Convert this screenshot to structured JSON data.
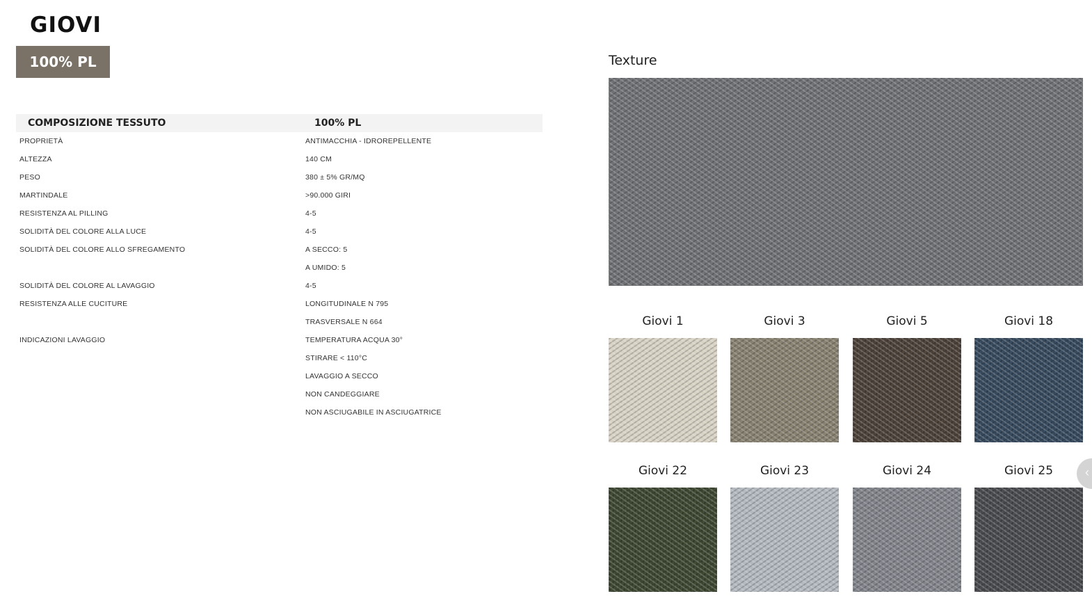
{
  "product": {
    "name": "GIOVI",
    "composition_badge": "100% PL"
  },
  "specs": {
    "header": {
      "label": "COMPOSIZIONE TESSUTO",
      "value": "100% PL"
    },
    "rows": [
      {
        "label": "PROPRIETÀ",
        "value": "ANTIMACCHIA - IDROREPELLENTE"
      },
      {
        "label": "ALTEZZA",
        "value": "140 CM"
      },
      {
        "label": "PESO",
        "value": "380 ± 5% GR/MQ"
      },
      {
        "label": "MARTINDALE",
        "value": ">90.000 GIRI"
      },
      {
        "label": "RESISTENZA AL PILLING",
        "value": "4-5"
      },
      {
        "label": "SOLIDITÀ DEL COLORE ALLA LUCE",
        "value": "4-5"
      },
      {
        "label": "SOLIDITÀ DEL COLORE ALLO SFREGAMENTO",
        "value": "A SECCO: 5"
      },
      {
        "label": "",
        "value": "A UMIDO: 5"
      },
      {
        "label": "SOLIDITÀ DEL COLORE AL LAVAGGIO",
        "value": "4-5"
      },
      {
        "label": "RESISTENZA ALLE CUCITURE",
        "value": "LONGITUDINALE N 795"
      },
      {
        "label": "",
        "value": "TRASVERSALE N 664"
      },
      {
        "label": "INDICAZIONI LAVAGGIO",
        "value": "TEMPERATURA ACQUA 30°"
      },
      {
        "label": "",
        "value": "STIRARE < 110°C"
      },
      {
        "label": "",
        "value": "LAVAGGIO A SECCO"
      },
      {
        "label": "",
        "value": "NON CANDEGGIARE"
      },
      {
        "label": "",
        "value": "NON ASCIUGABILE IN ASCIUGATRICE"
      }
    ]
  },
  "texture": {
    "title": "Texture",
    "color": "#6f7073"
  },
  "swatches": [
    {
      "name": "Giovi 1",
      "color": "#d8d2c4"
    },
    {
      "name": "Giovi 3",
      "color": "#86806f"
    },
    {
      "name": "Giovi 5",
      "color": "#4a4037"
    },
    {
      "name": "Giovi 18",
      "color": "#35485c"
    },
    {
      "name": "Giovi 22",
      "color": "#3c4530"
    },
    {
      "name": "Giovi 23",
      "color": "#b3b8bf"
    },
    {
      "name": "Giovi 24",
      "color": "#80838a"
    },
    {
      "name": "Giovi 25",
      "color": "#48494c"
    }
  ],
  "icons": {
    "scroll_button": "chevron-left-icon",
    "scroll_glyph": "‹"
  },
  "colors": {
    "badge_background": "#7a7167",
    "table_header_background": "#f3f3f3"
  }
}
